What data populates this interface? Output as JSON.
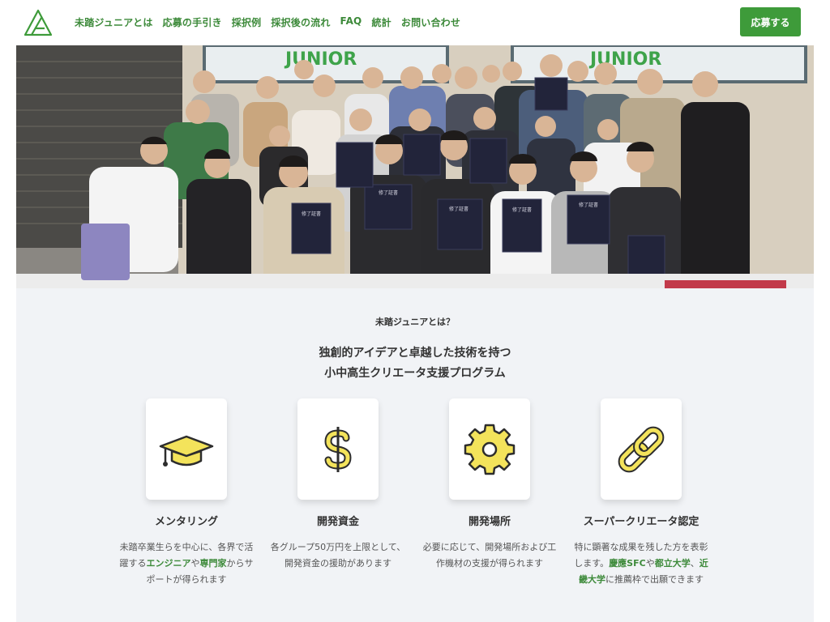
{
  "header": {
    "logo_icon": "mitou-junior-logo",
    "nav": [
      "未踏ジュニアとは",
      "応募の手引き",
      "採択例",
      "採択後の流れ",
      "FAQ",
      "統計",
      "お問い合わせ"
    ],
    "apply_label": "応募する",
    "accent_color": "#3e9b3a"
  },
  "hero": {
    "screen_text": "JUNIOR",
    "certificate_text": "修了証書",
    "description_icon": "group-photo"
  },
  "about": {
    "label": "未踏ジュニアとは？",
    "tagline_1": "独創的アイデアと卓越した技術を持つ",
    "tagline_2": "小中高生クリエータ支援プログラム"
  },
  "features": [
    {
      "icon": "graduation-cap-icon",
      "title": "メンタリング",
      "desc": [
        {
          "t": "未踏卒業生らを中心に、各界で活",
          "hl": false
        },
        {
          "t": "\n躍する",
          "hl": false
        },
        {
          "t": "エンジニア",
          "hl": true
        },
        {
          "t": "や",
          "hl": false
        },
        {
          "t": "専門家",
          "hl": true
        },
        {
          "t": "からサ\nポートが得られます",
          "hl": false
        }
      ]
    },
    {
      "icon": "dollar-icon",
      "title": "開発資金",
      "desc": [
        {
          "t": "各グループ50万円を上限として、\n開発資金の援助があります",
          "hl": false
        }
      ]
    },
    {
      "icon": "gear-icon",
      "title": "開発場所",
      "desc": [
        {
          "t": "必要に応じて、開発場所および工\n作機材の支援が得られます",
          "hl": false
        }
      ]
    },
    {
      "icon": "link-icon",
      "title": "スーパークリエータ認定",
      "desc": [
        {
          "t": "特に顕著な成果を残した方を表彰\nします。",
          "hl": false
        },
        {
          "t": "慶應SFC",
          "hl": true
        },
        {
          "t": "や",
          "hl": false
        },
        {
          "t": "都立大学",
          "hl": true
        },
        {
          "t": "、",
          "hl": false
        },
        {
          "t": "近\n畿大学",
          "hl": true
        },
        {
          "t": "に推薦枠で出願できます",
          "hl": false
        }
      ]
    }
  ]
}
